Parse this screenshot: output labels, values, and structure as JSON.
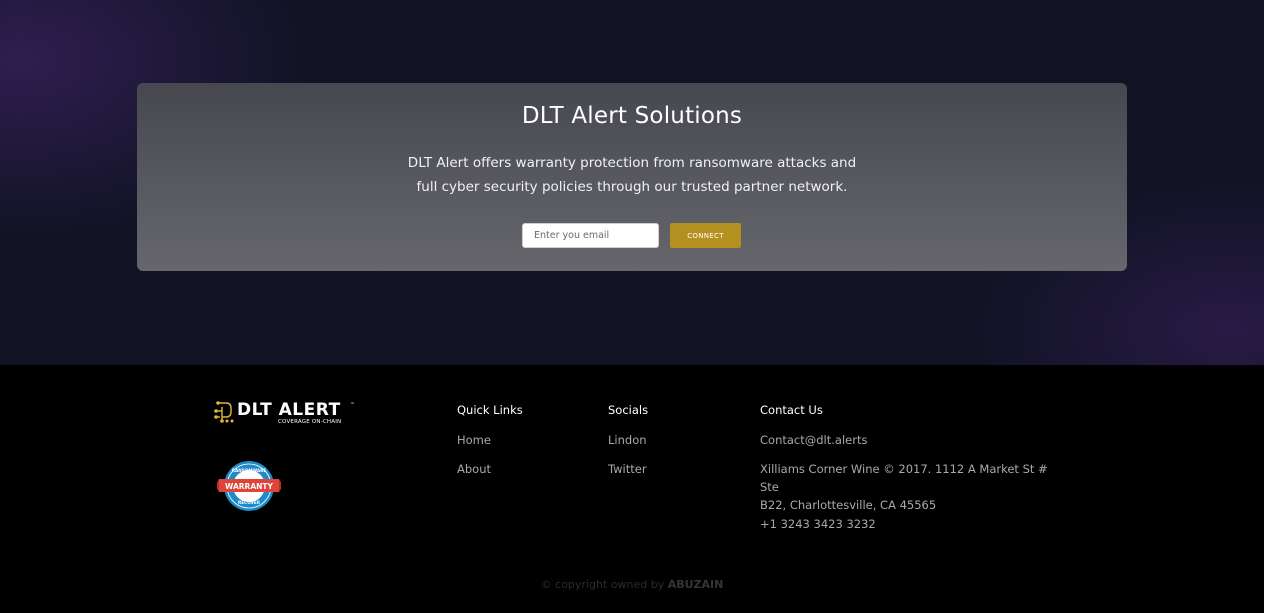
{
  "hero": {
    "title": "DLT Alert Solutions",
    "description_line1": "DLT Alert offers warranty protection from ransomware attacks and",
    "description_line2": "full cyber security policies through our trusted partner network.",
    "email_placeholder": "Enter you email",
    "email_value": "",
    "connect_label": "CONNECT"
  },
  "footer": {
    "logo": {
      "name": "DLT ALERT",
      "trademark": "™",
      "tagline": "COVERAGE ON-CHAIN",
      "icon": "circuit-logo-icon"
    },
    "badge": {
      "icon": "ransomware-warranty-badge-icon",
      "top_text": "RANSOMWARE",
      "middle_text": "WARRANTY",
      "bottom_text": "RECOVER"
    },
    "quick_links": {
      "title": "Quick Links",
      "items": [
        "Home",
        "About"
      ]
    },
    "socials": {
      "title": "Socials",
      "items": [
        "Lindon",
        "Twitter"
      ]
    },
    "contact": {
      "title": "Contact Us",
      "email": "Contact@dlt.alerts",
      "address_line1": "Xilliams Corner Wine © 2017. 1112 A Market St # Ste",
      "address_line2": "B22, Charlottesville, CA 45565",
      "phone": "+1 3243 3423 3232"
    },
    "copyright_prefix": "© copyright owned by ",
    "copyright_owner": "ABUZAIN"
  },
  "colors": {
    "accent": "#b3901f",
    "hero_bg": "#111324",
    "footer_bg": "#000000",
    "link_gray": "#a9a9a9"
  }
}
